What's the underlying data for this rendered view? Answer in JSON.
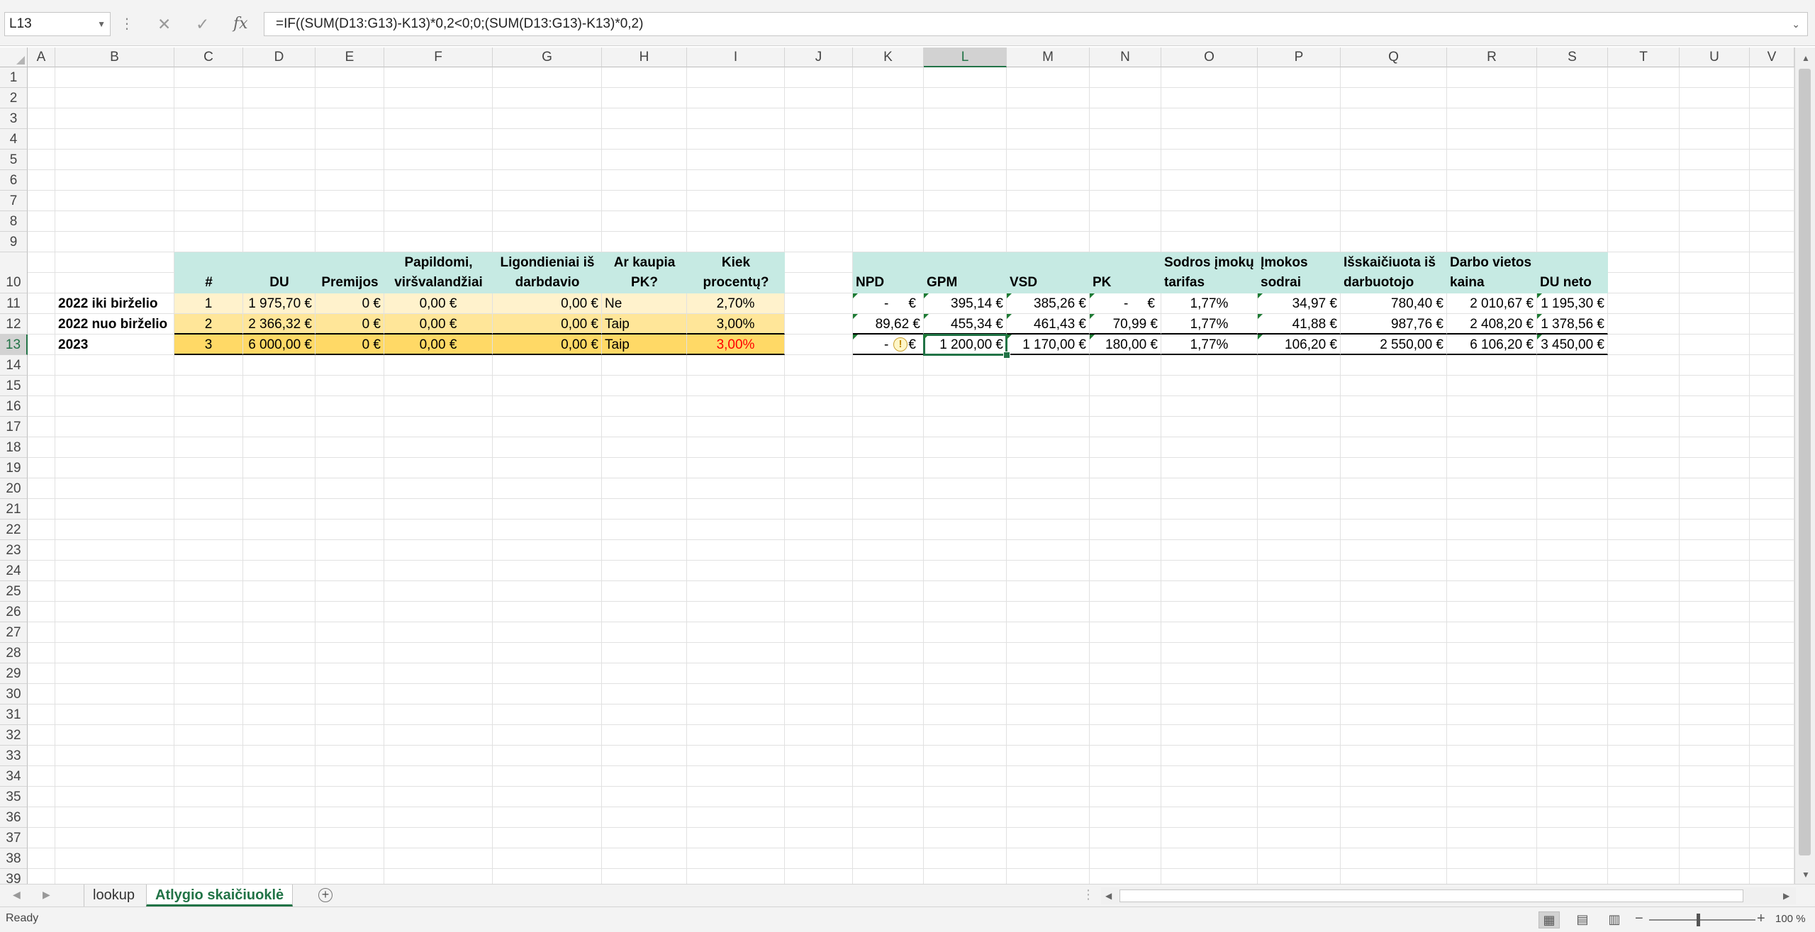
{
  "formula_bar": {
    "name_box": "L13",
    "cancel_glyph": "✕",
    "enter_glyph": "✓",
    "fx_label": "fx",
    "formula": "=IF((SUM(D13:G13)-K13)*0,2<0;0;(SUM(D13:G13)-K13)*0,2)"
  },
  "columns": [
    "A",
    "B",
    "C",
    "D",
    "E",
    "F",
    "G",
    "H",
    "I",
    "J",
    "K",
    "L",
    "M",
    "N",
    "O",
    "P",
    "Q",
    "R",
    "S",
    "T",
    "U",
    "V"
  ],
  "selected_column": "L",
  "rows": [
    "1",
    "2",
    "3",
    "4",
    "5",
    "6",
    "7",
    "8",
    "9",
    "10",
    "11",
    "12",
    "13",
    "14",
    "15",
    "16",
    "17",
    "18",
    "19",
    "20",
    "21",
    "22",
    "23",
    "24",
    "25",
    "26",
    "27",
    "28",
    "29",
    "30",
    "31",
    "32",
    "33",
    "34",
    "35",
    "36",
    "37",
    "38",
    "39"
  ],
  "selected_row": "13",
  "left_table": {
    "headers": {
      "C": [
        "#"
      ],
      "D": [
        "DU"
      ],
      "E": [
        "Premijos"
      ],
      "F": [
        "Papildomi,",
        "viršvalandžiai"
      ],
      "G": [
        "Ligondieniai iš",
        "darbdavio"
      ],
      "H": [
        "Ar kaupia",
        "PK?"
      ],
      "I": [
        "Kiek",
        "procentų?"
      ]
    },
    "rows": [
      {
        "label": "2022 iki birželio",
        "num": "1",
        "du": "1 975,70 €",
        "premijos": "0 €",
        "papildomi": "0,00 €",
        "ligon": "0,00 €",
        "pk": "Ne",
        "proc": "2,70%"
      },
      {
        "label": "2022 nuo birželio",
        "num": "2",
        "du": "2 366,32 €",
        "premijos": "0 €",
        "papildomi": "0,00 €",
        "ligon": "0,00 €",
        "pk": "Taip",
        "proc": "3,00%"
      },
      {
        "label": "2023",
        "num": "3",
        "du": "6 000,00 €",
        "premijos": "0 €",
        "papildomi": "0,00 €",
        "ligon": "0,00 €",
        "pk": "Taip",
        "proc": "3,00%"
      }
    ]
  },
  "right_table": {
    "headers": {
      "K": [
        "NPD"
      ],
      "L": [
        "GPM"
      ],
      "M": [
        "VSD"
      ],
      "N": [
        "PK"
      ],
      "O": [
        "Sodros įmokų",
        "tarifas"
      ],
      "P": [
        "Įmokos",
        "sodrai"
      ],
      "Q": [
        "Išskaičiuota iš",
        "darbuotojo"
      ],
      "R": [
        "Darbo vietos",
        "kaina"
      ],
      "S": [
        "DU neto"
      ]
    },
    "rows": [
      {
        "npd": "-",
        "npd_unit": "€",
        "gpm": "395,14 €",
        "vsd": "385,26 €",
        "pk": "-",
        "pk_unit": "€",
        "tarifas": "1,77%",
        "imokos": "34,97 €",
        "isskaic": "780,40 €",
        "kaina": "2 010,67 €",
        "neto": "1 195,30 €"
      },
      {
        "npd": "89,62 €",
        "npd_unit": "",
        "gpm": "455,34 €",
        "vsd": "461,43 €",
        "pk": "70,99 €",
        "pk_unit": "",
        "tarifas": "1,77%",
        "imokos": "41,88 €",
        "isskaic": "987,76 €",
        "kaina": "2 408,20 €",
        "neto": "1 378,56 €"
      },
      {
        "npd": "-",
        "npd_unit": "€",
        "gpm": "1 200,00 €",
        "vsd": "1 170,00 €",
        "pk": "180,00 €",
        "pk_unit": "",
        "tarifas": "1,77%",
        "imokos": "106,20 €",
        "isskaic": "2 550,00 €",
        "kaina": "6 106,20 €",
        "neto": "3 450,00 €"
      }
    ],
    "warning_glyph": "!"
  },
  "sheet_tabs": {
    "tabs": [
      "lookup",
      "Atlygio skaičiuoklė"
    ],
    "active": "Atlygio skaičiuoklė",
    "add_glyph": "+"
  },
  "status": {
    "text": "Ready",
    "zoom": "100 %",
    "zoom_minus": "−",
    "zoom_plus": "+"
  },
  "colors": {
    "accent": "#217346",
    "header_fill": "#c6eae3",
    "row_fill_1": "#fff2cc",
    "row_fill_2": "#ffe699",
    "row_fill_3": "#ffd966",
    "red_text": "#ff0000"
  }
}
